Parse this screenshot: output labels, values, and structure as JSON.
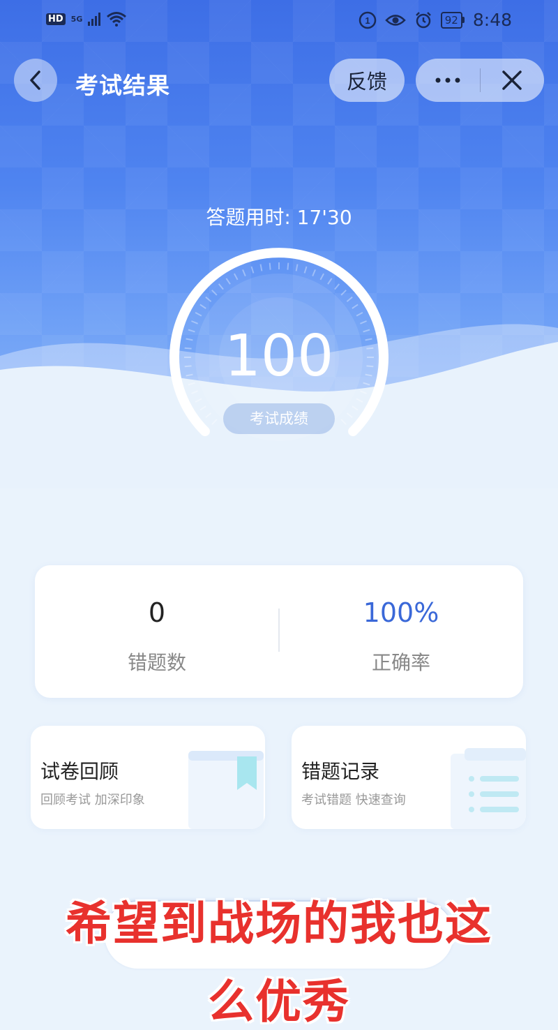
{
  "status_bar": {
    "hd": "HD",
    "network": "5G",
    "battery": "92",
    "time": "8:48"
  },
  "header": {
    "title": "考试结果",
    "feedback_label": "反馈"
  },
  "result": {
    "time_used": "答题用时: 17'30",
    "score": "100",
    "score_label": "考试成绩"
  },
  "stats": {
    "wrong_count": "0",
    "wrong_label": "错题数",
    "accuracy": "100%",
    "accuracy_label": "正确率"
  },
  "entries": [
    {
      "title": "试卷回顾",
      "subtitle": "回顾考试 加深印象"
    },
    {
      "title": "错题记录",
      "subtitle": "考试错题 快速查询"
    }
  ],
  "overlay": {
    "caption_line1": "希望到战场的我也这",
    "caption_line2": "么优秀"
  },
  "colors": {
    "primary_blue": "#3d6ee6",
    "accent_blue": "#3a68d8",
    "caption_red": "#e8312d"
  }
}
